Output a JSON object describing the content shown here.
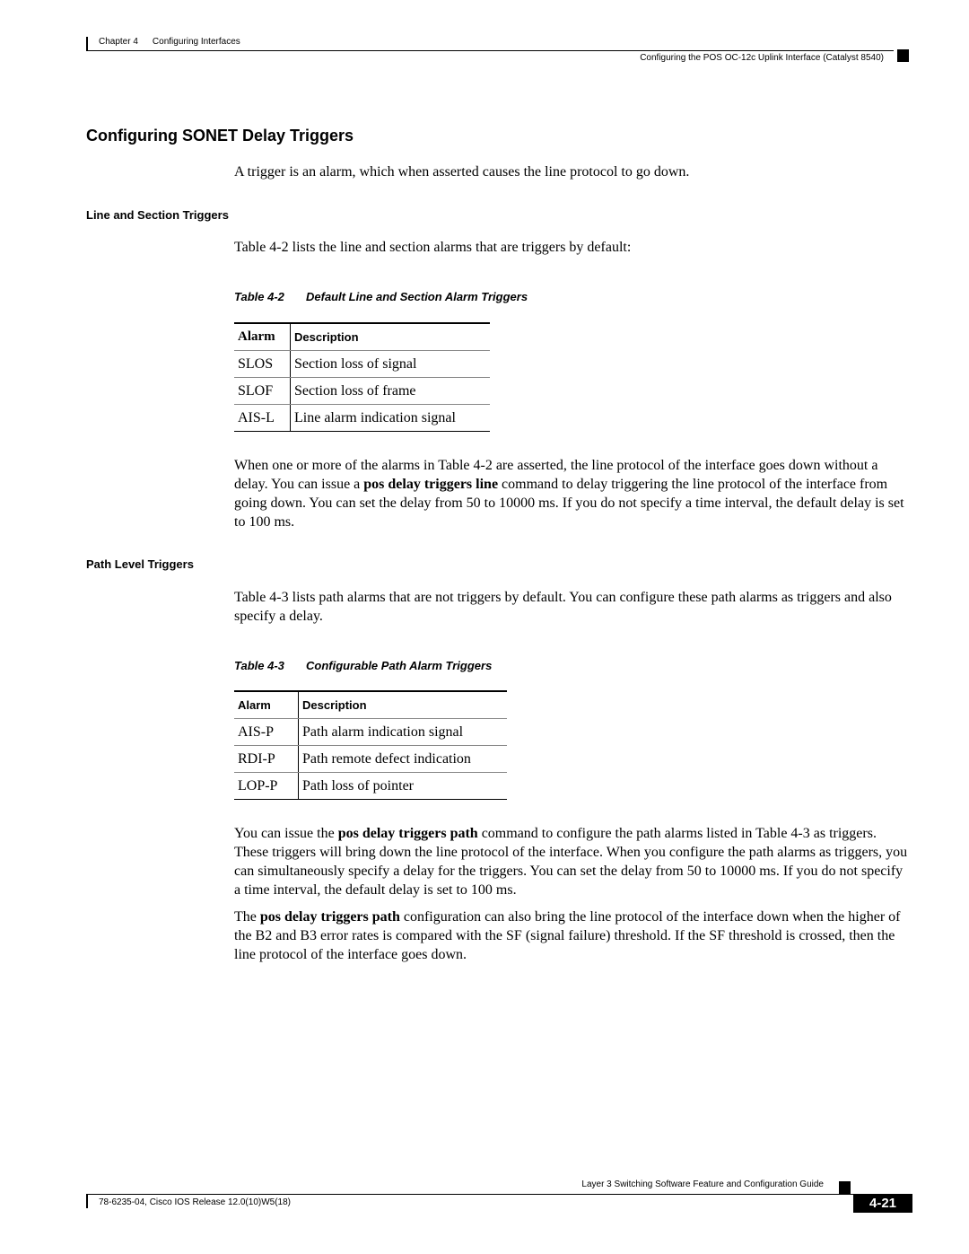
{
  "header": {
    "chapter_label": "Chapter 4",
    "chapter_title": "Configuring Interfaces",
    "section_running_title": "Configuring the POS OC-12c Uplink Interface (Catalyst 8540)"
  },
  "main": {
    "title": "Configuring SONET Delay Triggers",
    "intro": "A trigger is an alarm, which when asserted causes the line protocol to go down.",
    "line_section": {
      "heading": "Line and Section Triggers",
      "lead": "Table 4-2 lists the line and section alarms that are triggers by default:",
      "table": {
        "caption_num": "Table 4-2",
        "caption_title": "Default Line and Section Alarm Triggers",
        "columns": [
          "Alarm",
          "Description"
        ],
        "rows": [
          [
            "SLOS",
            "Section loss of signal"
          ],
          [
            "SLOF",
            "Section loss of frame"
          ],
          [
            "AIS-L",
            "Line alarm indication signal"
          ]
        ]
      },
      "para": {
        "part1": "When one or more of the alarms in Table 4-2 are asserted, the line protocol of the interface goes down without a delay. You can issue a ",
        "cmd": "pos delay triggers line",
        "part2": " command to delay triggering the line protocol of the interface from going down. You can set the delay from 50 to 10000 ms. If you do not specify a time interval, the default delay is set to 100 ms."
      }
    },
    "path_level": {
      "heading": "Path Level Triggers",
      "lead": "Table 4-3 lists path alarms that are not triggers by default. You can configure these path alarms as triggers and also specify a delay.",
      "table": {
        "caption_num": "Table 4-3",
        "caption_title": "Configurable Path Alarm Triggers",
        "columns": [
          "Alarm",
          "Description"
        ],
        "rows": [
          [
            "AIS-P",
            "Path alarm indication signal"
          ],
          [
            "RDI-P",
            "Path remote defect indication"
          ],
          [
            "LOP-P",
            "Path loss of pointer"
          ]
        ]
      },
      "para1": {
        "part1": "You can issue the ",
        "cmd": "pos delay triggers path",
        "part2": " command to configure the path alarms listed in Table 4-3 as triggers. These triggers will bring down the line protocol of the interface. When you configure the path alarms as triggers, you can simultaneously specify a delay for the triggers. You can set the delay from 50 to 10000 ms. If you do not specify a time interval, the default delay is set to 100 ms."
      },
      "para2": {
        "part1": "The ",
        "cmd": "pos delay triggers path",
        "part2": " configuration can also bring the line protocol of the interface down when the higher of the B2 and B3 error rates is compared with the SF (signal failure) threshold. If the SF threshold is crossed, then the line protocol of the interface goes down."
      }
    }
  },
  "footer": {
    "guide_title": "Layer 3 Switching Software Feature and Configuration Guide",
    "release": "78-6235-04, Cisco IOS Release 12.0(10)W5(18)",
    "page_number": "4-21"
  }
}
